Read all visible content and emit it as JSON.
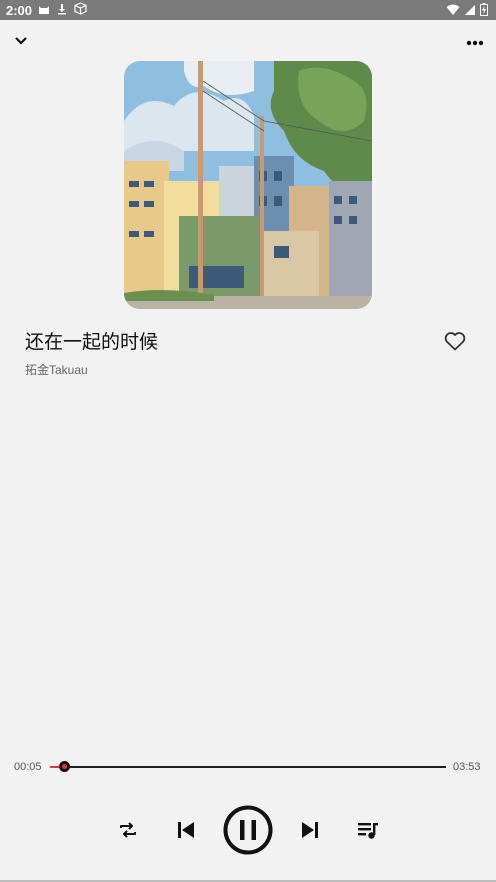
{
  "status_bar": {
    "time": "2:00",
    "left_icons": [
      "cat-icon",
      "download-icon",
      "package-icon"
    ],
    "right_icons": [
      "wifi-icon",
      "signal-icon",
      "battery-icon"
    ]
  },
  "header": {
    "collapse_icon": "chevron-down-icon",
    "more_icon": "more-horizontal-icon"
  },
  "track": {
    "title": "还在一起的时候",
    "artist": "拓金Takuau",
    "liked": false
  },
  "progress": {
    "elapsed": "00:05",
    "duration": "03:53",
    "fraction": 0.0357
  },
  "controls": {
    "repeat_icon": "repeat-icon",
    "previous_icon": "skip-previous-icon",
    "play_state": "playing",
    "pause_icon": "pause-icon",
    "next_icon": "skip-next-icon",
    "queue_icon": "queue-music-icon"
  },
  "colors": {
    "accent": "#e33333",
    "background": "#f2f2f2",
    "status_bar": "#7a7a7a"
  }
}
